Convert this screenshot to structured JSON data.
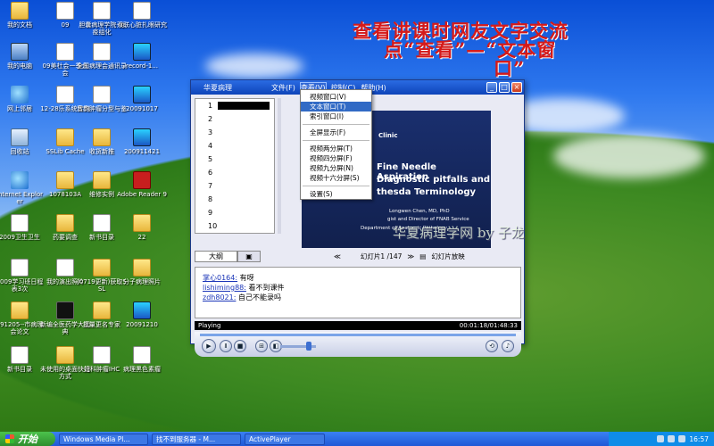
{
  "overlay": {
    "line1": "查看讲课时网友文字交流",
    "line2": "点“查看”—“文本窗",
    "line3": "口”"
  },
  "watermark": "华夏病理学网 by 子龙",
  "desktop_icons": [
    {
      "label": "我的文档",
      "type": "folder"
    },
    {
      "label": "09",
      "type": "doc"
    },
    {
      "label": "胆囊病理学院-免疫组化",
      "type": "doc"
    },
    {
      "label": "双联心脏扎眼研究",
      "type": "doc"
    },
    {
      "label": "我的电脑",
      "type": "pc"
    },
    {
      "label": "09美杜会一季大会",
      "type": "doc"
    },
    {
      "label": "全国病理会通讯录",
      "type": "doc"
    },
    {
      "label": "record-1...",
      "type": "media"
    },
    {
      "label": "网上邻居",
      "type": "globe"
    },
    {
      "label": "12-28乐系统实例",
      "type": "doc"
    },
    {
      "label": "音韵肿瘤分型与鉴",
      "type": "doc"
    },
    {
      "label": "20091017",
      "type": "media"
    },
    {
      "label": "回收站",
      "type": "bin"
    },
    {
      "label": "SSLib Cache",
      "type": "folder"
    },
    {
      "label": "收货新推",
      "type": "folder"
    },
    {
      "label": "200911421",
      "type": "media"
    },
    {
      "label": "Internet Explorer",
      "type": "globe"
    },
    {
      "label": "1078103A",
      "type": "folder"
    },
    {
      "label": "维修实例",
      "type": "folder"
    },
    {
      "label": "Adobe Reader 9",
      "type": "red"
    },
    {
      "label": "2009卫生卫生",
      "type": "doc"
    },
    {
      "label": "药要调查",
      "type": "folder"
    },
    {
      "label": "新书目录",
      "type": "doc"
    },
    {
      "label": "22",
      "type": "folder"
    },
    {
      "label": "2009学习班日程表3次",
      "type": "doc"
    },
    {
      "label": "我的演出照片",
      "type": "doc"
    },
    {
      "label": "(0719更新)获取SSL",
      "type": "folder"
    },
    {
      "label": "分子病理照片",
      "type": "folder"
    },
    {
      "label": "091205--市病理会论文",
      "type": "folder"
    },
    {
      "label": "新编全医药学大词典",
      "type": "black"
    },
    {
      "label": "批量更名专家",
      "type": "folder"
    },
    {
      "label": "20091210",
      "type": "media"
    },
    {
      "label": "新书目录",
      "type": "doc"
    },
    {
      "label": "未使用的桌面快捷方式",
      "type": "folder"
    },
    {
      "label": "妇科肿瘤IHC",
      "type": "doc"
    },
    {
      "label": "病理黑色素瘤",
      "type": "doc"
    }
  ],
  "player": {
    "title": "华夏病理",
    "menus": [
      "文件(F)",
      "查看(V)",
      "控制(C)",
      "帮助(H)"
    ],
    "active_menu_index": 1,
    "list_numbers": [
      "1",
      "2",
      "3",
      "4",
      "5",
      "6",
      "7",
      "8",
      "9",
      "10"
    ],
    "slide": {
      "clinic": "Clinic",
      "title1": "Fine Needle Aspiration",
      "title2": "Diagnostic pitfalls and",
      "title3": "thesda Terminology",
      "author": "Longwen Chen, MD, PhD",
      "role": "gist and Director of FNAB Service",
      "dept": "Department of Anatomic Pathology"
    },
    "tab_outline": "大纲",
    "slide_label": "幻灯片1 /147",
    "slide_play": "幻灯片放映",
    "chat": [
      {
        "user": "掌心0164",
        "text": "有呀"
      },
      {
        "user": "lishiming88",
        "text": "看不到课件"
      },
      {
        "user": "zdh8021",
        "text": "自己不能录吗"
      }
    ],
    "status": "Playing",
    "time": "00:01:18/01:48:33"
  },
  "view_menu": {
    "items": [
      {
        "label": "视频窗口(V)",
        "selected": false
      },
      {
        "label": "文本窗口(T)",
        "selected": true
      },
      {
        "label": "索引窗口(I)",
        "selected": false
      },
      {
        "sep": true
      },
      {
        "label": "全屏显示(F)",
        "selected": false
      },
      {
        "sep": true
      },
      {
        "label": "视频两分屏(T)",
        "selected": false
      },
      {
        "label": "视频四分屏(F)",
        "selected": false
      },
      {
        "label": "视频九分屏(N)",
        "selected": false
      },
      {
        "label": "视频十六分屏(S)",
        "selected": false
      },
      {
        "sep": true
      },
      {
        "label": "设置(S)",
        "selected": false
      }
    ]
  },
  "taskbar": {
    "start": "开始",
    "buttons": [
      "Windows Media Pl...",
      "找不到服务器 - M...",
      "ActivePlayer"
    ],
    "clock": "16:57"
  }
}
